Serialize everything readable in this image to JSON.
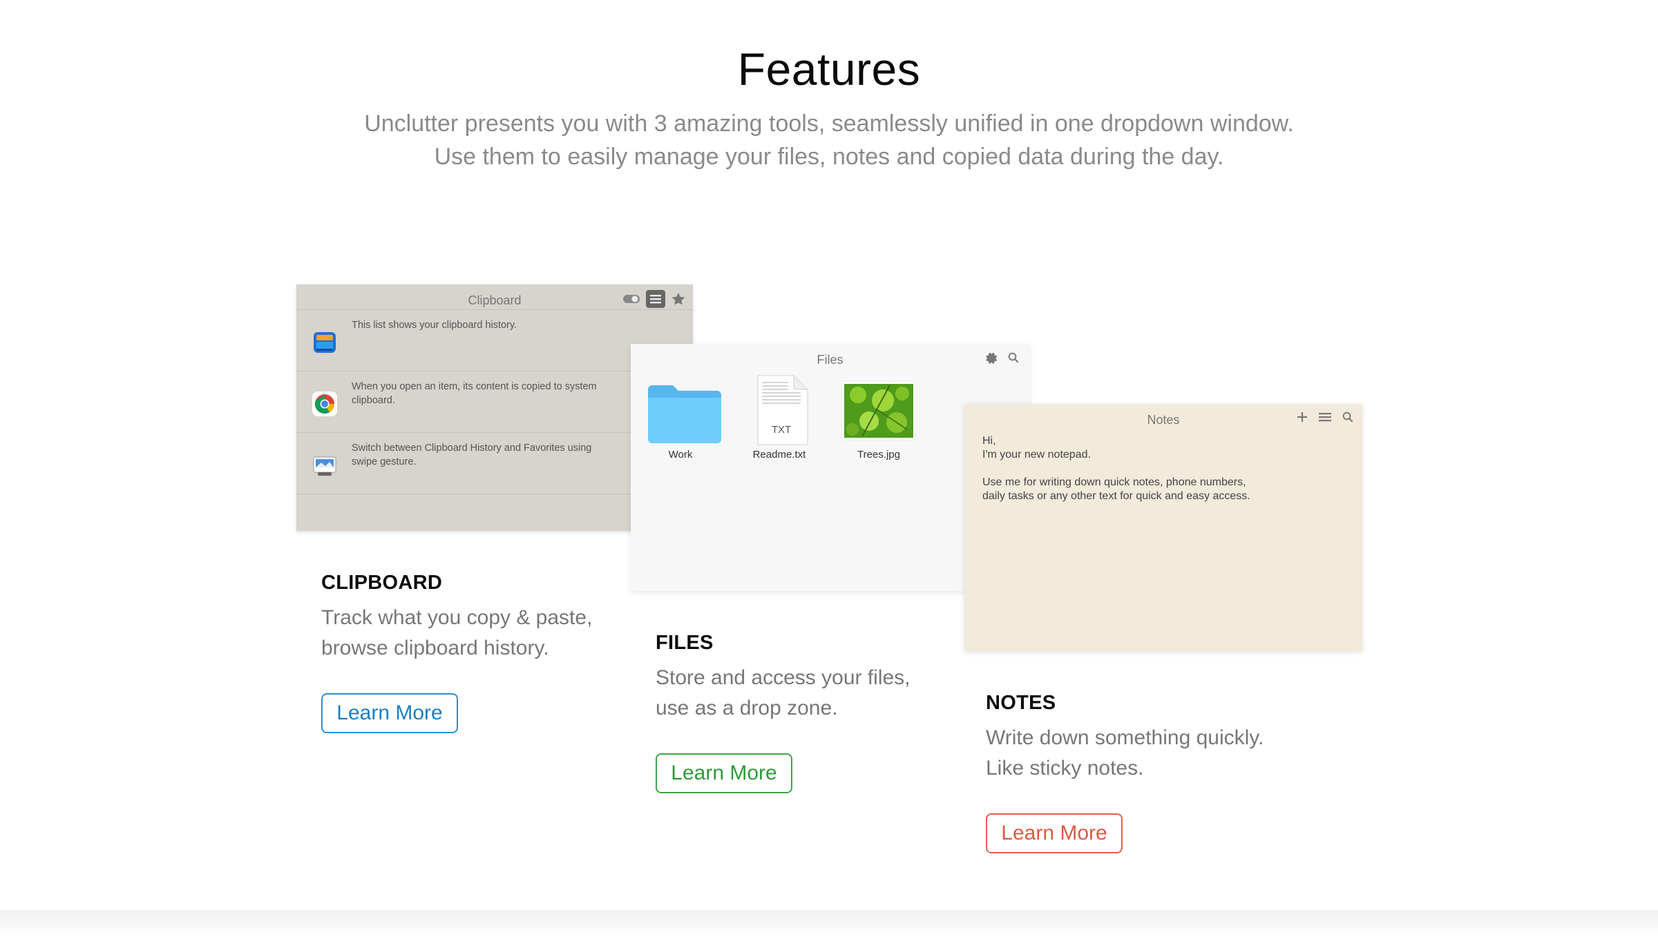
{
  "header": {
    "title": "Features",
    "subtitle_line1": "Unclutter presents you with 3 amazing tools, seamlessly unified in one dropdown window.",
    "subtitle_line2": "Use them to easily manage your files, notes and copied data during the day."
  },
  "clipboard_window": {
    "title": "Clipboard",
    "toolbar_icons": [
      "toggle-icon",
      "list-icon",
      "star-icon"
    ],
    "rows": [
      {
        "icon": "app-store-icon",
        "text": "This list shows your clipboard history."
      },
      {
        "icon": "chrome-icon",
        "text": "When you open an item, its content is copied to system clipboard."
      },
      {
        "icon": "preview-icon",
        "text": "Switch between Clipboard History and Favorites using swipe gesture."
      }
    ]
  },
  "files_window": {
    "title": "Files",
    "toolbar_icons": [
      "gear-icon",
      "search-icon"
    ],
    "items": [
      {
        "label": "Work",
        "icon": "folder-icon"
      },
      {
        "label": "Readme.txt",
        "icon": "txt-file-icon",
        "badge": "TXT"
      },
      {
        "label": "Trees.jpg",
        "icon": "image-thumbnail-icon"
      }
    ]
  },
  "notes_window": {
    "title": "Notes",
    "toolbar_icons": [
      "plus-icon",
      "list-icon",
      "search-icon"
    ],
    "body": "Hi,\nI'm your new notepad.\n\nUse me for writing down quick notes, phone numbers,\ndaily tasks or any other text for quick and easy access."
  },
  "features": [
    {
      "title": "CLIPBOARD",
      "desc_line1": "Track what you copy & paste,",
      "desc_line2": "browse clipboard history.",
      "button": "Learn More",
      "color": "#1b7fc4"
    },
    {
      "title": "FILES",
      "desc_line1": "Store and access your files,",
      "desc_line2": "use as a drop zone.",
      "button": "Learn More",
      "color": "#2e9a3a"
    },
    {
      "title": "NOTES",
      "desc_line1": "Write down something quickly.",
      "desc_line2": "Like sticky notes.",
      "button": "Learn More",
      "color": "#dc5a43"
    }
  ]
}
